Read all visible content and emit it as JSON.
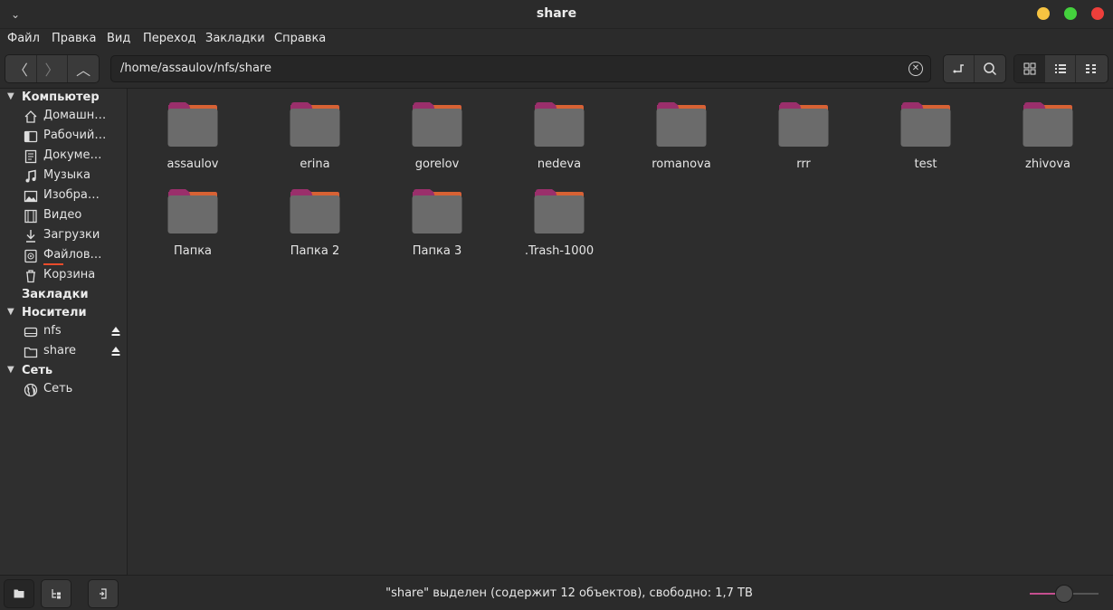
{
  "window": {
    "title": "share"
  },
  "menu": [
    "Файл",
    "Правка",
    "Вид",
    "Переход",
    "Закладки",
    "Справка"
  ],
  "toolbar": {
    "path": "/home/assaulov/nfs/share"
  },
  "sidebar": {
    "computer_header": "Компьютер",
    "computer_items": [
      {
        "label": "Домашн…",
        "icon": "home-icon"
      },
      {
        "label": "Рабочий…",
        "icon": "desktop-icon"
      },
      {
        "label": "Докумен…",
        "icon": "document-icon"
      },
      {
        "label": "Музыка",
        "icon": "music-icon"
      },
      {
        "label": "Изобра…",
        "icon": "image-icon"
      },
      {
        "label": "Видео",
        "icon": "video-icon"
      },
      {
        "label": "Загрузки",
        "icon": "download-icon"
      },
      {
        "label": "Файлова…",
        "icon": "filesystem-icon"
      },
      {
        "label": "Корзина",
        "icon": "trash-icon"
      }
    ],
    "bookmarks_header": "Закладки",
    "devices_header": "Носители",
    "devices": [
      {
        "label": "nfs",
        "icon": "drive-icon"
      },
      {
        "label": "share",
        "icon": "folder-icon"
      }
    ],
    "network_header": "Сеть",
    "network_items": [
      {
        "label": "Сеть",
        "icon": "globe-icon"
      }
    ]
  },
  "files": [
    "assaulov",
    "erina",
    "gorelov",
    "nedeva",
    "romanova",
    "rrr",
    "test",
    "zhivova",
    "Папка",
    "Папка 2",
    "Папка 3",
    ".Trash-1000"
  ],
  "status": {
    "text": "\"share\" выделен (содержит 12 объектов), свободно: 1,7 ТВ"
  },
  "zoom": {
    "level": 0.5
  },
  "colors": {
    "folder_body": "#6b6b6b",
    "folder_tab": "#9a2f6b",
    "folder_tab_edge": "#e26b2a",
    "accent": "#c44f8f"
  }
}
